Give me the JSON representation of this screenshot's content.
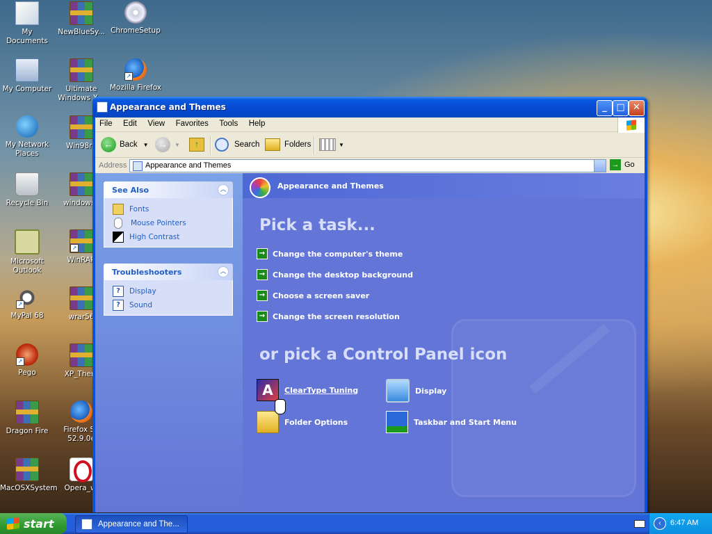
{
  "desktop": {
    "icons": [
      {
        "label": "My Documents"
      },
      {
        "label": "NewBlueSy..."
      },
      {
        "label": "ChromeSetup"
      },
      {
        "label": "My Computer"
      },
      {
        "label": "Ultimate Windows X..."
      },
      {
        "label": "Mozilla Firefox"
      },
      {
        "label": "My Network Places"
      },
      {
        "label": "Win98rd"
      },
      {
        "label": "Recycle Bin"
      },
      {
        "label": "windows2"
      },
      {
        "label": "Microsoft Outlook"
      },
      {
        "label": "WinRAR"
      },
      {
        "label": "MyPal 68"
      },
      {
        "label": "wrar56"
      },
      {
        "label": "Pego"
      },
      {
        "label": "XP_Them"
      },
      {
        "label": "Dragon Fire"
      },
      {
        "label": "Firefox Se 52.9.0e"
      },
      {
        "label": "MacOSXSystem"
      },
      {
        "label": "Opera_wi"
      }
    ]
  },
  "window": {
    "title": "Appearance and Themes",
    "menu": [
      "File",
      "Edit",
      "View",
      "Favorites",
      "Tools",
      "Help"
    ],
    "toolbar": {
      "back": "Back",
      "search": "Search",
      "folders": "Folders"
    },
    "address": {
      "label": "Address",
      "value": "Appearance and Themes",
      "go": "Go"
    }
  },
  "sidebar": {
    "see_also": {
      "title": "See Also",
      "items": [
        "Fonts",
        "Mouse Pointers",
        "High Contrast"
      ]
    },
    "troubleshooters": {
      "title": "Troubleshooters",
      "items": [
        "Display",
        "Sound"
      ]
    }
  },
  "main": {
    "header": "Appearance and Themes",
    "pick_task": "Pick a task...",
    "tasks": [
      "Change the computer's theme",
      "Change the desktop background",
      "Choose a screen saver",
      "Change the screen resolution"
    ],
    "pick_icon": "or pick a Control Panel icon",
    "icons": [
      "ClearType Tuning",
      "Display",
      "Folder Options",
      "Taskbar and Start Menu"
    ]
  },
  "taskbar": {
    "start": "start",
    "task_button": "Appearance and The...",
    "clock": "6:47 AM"
  }
}
